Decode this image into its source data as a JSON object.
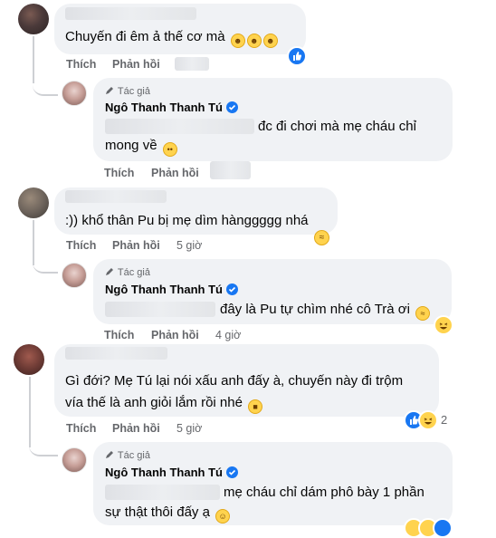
{
  "actions": {
    "like": "Thích",
    "reply": "Phản hồi"
  },
  "author_tag": "Tác giả",
  "author_name": "Ngô Thanh Thanh Tú",
  "comments": [
    {
      "text": "Chuyến đi êm ả thế cơ mà",
      "emoji": [
        "rolling-on-floor-laughing",
        "rolling-on-floor-laughing",
        "rolling-on-floor-laughing"
      ],
      "reaction": "like",
      "reply": {
        "line1": "đc đi chơi mà mẹ cháu chỉ",
        "line2": "mong về",
        "line2_emoji": "pleading-face"
      }
    },
    {
      "text": ":)) khổ thân Pu bị mẹ dìm hànggggg nhá",
      "emoji": [
        "squinting-tongue-face"
      ],
      "time": "5 giờ",
      "reply": {
        "line1": "đây là Pu tự chìm nhé cô Trà ơi",
        "line1_emoji": "grinning-squinting-face",
        "time": "4 giờ",
        "reaction": "haha"
      }
    },
    {
      "line1": "Gì đới? Mẹ Tú lại nói xấu anh đấy à, chuyến này đi trộm",
      "line2": "vía thế là anh giỏi lắm rồi nhé",
      "line2_emoji": "smiling-face-with-sunglasses",
      "time": "5 giờ",
      "reaction_count": "2",
      "reply": {
        "line1": "mẹ cháu chỉ dám phô bày 1 phần",
        "line2": "sự thật thôi đấy ạ",
        "line2_emoji": "upside-down-face"
      }
    }
  ]
}
